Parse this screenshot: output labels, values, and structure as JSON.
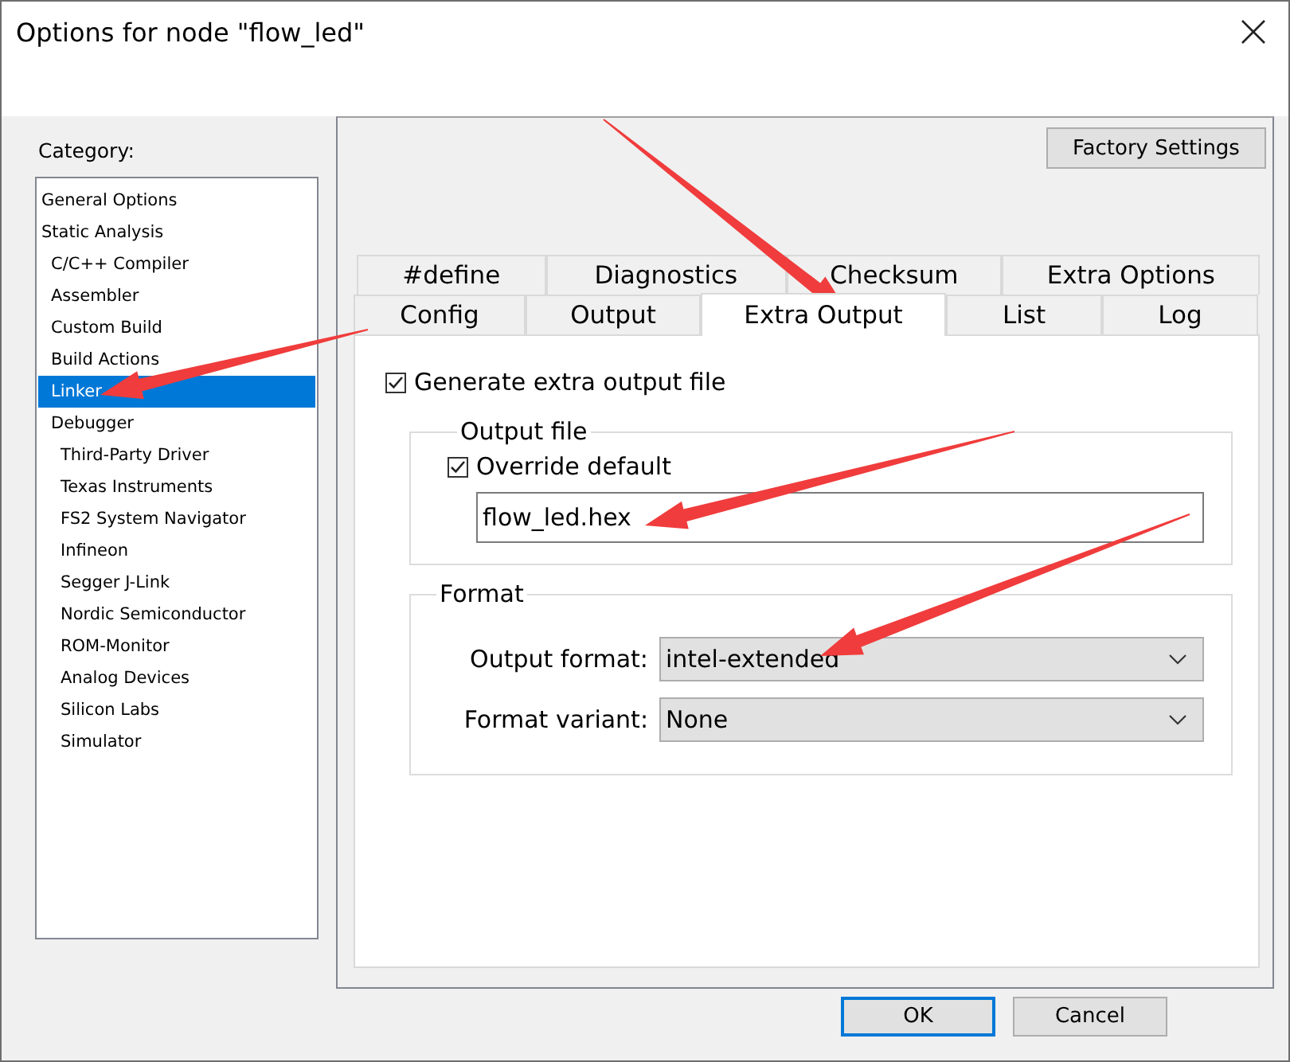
{
  "window": {
    "title": "Options for node \"flow_led\""
  },
  "category": {
    "label": "Category:",
    "items": [
      {
        "label": "General Options",
        "selected": false
      },
      {
        "label": "Static Analysis",
        "selected": false,
        "children": [
          {
            "label": "C/C++ Compiler",
            "selected": false
          },
          {
            "label": "Assembler",
            "selected": false
          },
          {
            "label": "Custom Build",
            "selected": false
          },
          {
            "label": "Build Actions",
            "selected": false
          },
          {
            "label": "Linker",
            "selected": true
          },
          {
            "label": "Debugger",
            "selected": false,
            "children": [
              {
                "label": "Third-Party Driver",
                "selected": false
              },
              {
                "label": "Texas Instruments",
                "selected": false
              },
              {
                "label": "FS2 System Navigator",
                "selected": false
              },
              {
                "label": "Infineon",
                "selected": false
              },
              {
                "label": "Segger J-Link",
                "selected": false
              },
              {
                "label": "Nordic Semiconductor",
                "selected": false
              },
              {
                "label": "ROM-Monitor",
                "selected": false
              },
              {
                "label": "Analog Devices",
                "selected": false
              },
              {
                "label": "Silicon Labs",
                "selected": false
              },
              {
                "label": "Simulator",
                "selected": false
              }
            ]
          }
        ]
      }
    ]
  },
  "factory_button": "Factory Settings",
  "tab_rows": [
    [
      {
        "label": "#define",
        "selected": false
      },
      {
        "label": "Diagnostics",
        "selected": false
      },
      {
        "label": "Checksum",
        "selected": false
      },
      {
        "label": "Extra Options",
        "selected": false
      }
    ],
    [
      {
        "label": "Config",
        "selected": false
      },
      {
        "label": "Output",
        "selected": false
      },
      {
        "label": "Extra Output",
        "selected": true
      },
      {
        "label": "List",
        "selected": false
      },
      {
        "label": "Log",
        "selected": false
      }
    ]
  ],
  "generate": {
    "label": "Generate extra output file",
    "checked": true
  },
  "output_file": {
    "title": "Output file",
    "override": {
      "label": "Override default",
      "checked": true
    },
    "value": "flow_led.hex"
  },
  "format": {
    "title": "Format",
    "fields": [
      {
        "label": "Output format:",
        "value": "intel-extended"
      },
      {
        "label": "Format variant:",
        "value": "None"
      }
    ]
  },
  "buttons": [
    {
      "label": "OK",
      "default": true
    },
    {
      "label": "Cancel",
      "default": false
    }
  ]
}
